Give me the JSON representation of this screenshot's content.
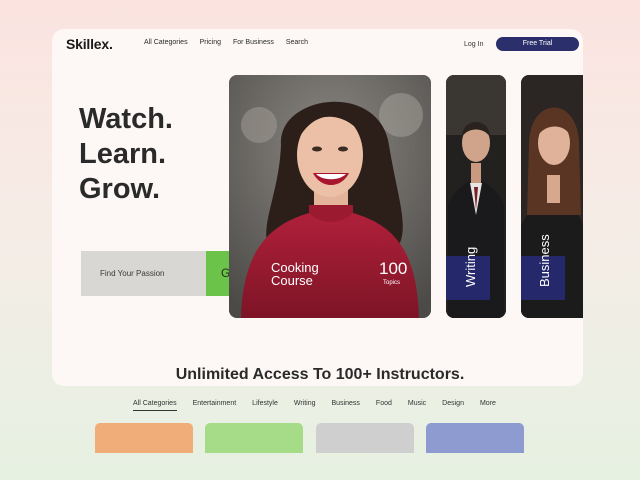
{
  "brand": {
    "name": "Skillex",
    "dot": "."
  },
  "nav": {
    "items": [
      "All Categories",
      "Pricing",
      "For Business",
      "Search"
    ],
    "login": "Log In",
    "trial": "Free Trial"
  },
  "hero": {
    "lines": [
      "Watch.",
      "Learn.",
      "Grow."
    ],
    "search_placeholder": "Find Your Passion",
    "go": "Go",
    "course_line1": "Cooking",
    "course_line2": "Course",
    "topics_count": "100",
    "topics_label": "Topics",
    "side_cards": [
      "Writing",
      "Business"
    ]
  },
  "section": {
    "title": "Unlimited Access To 100+ Instructors.",
    "tabs": [
      "All Categories",
      "Entertainment",
      "Lifestyle",
      "Writing",
      "Business",
      "Food",
      "Music",
      "Design",
      "More"
    ],
    "active_tab": "All Categories"
  },
  "colors": {
    "accent_navy": "#2b2f6b",
    "go_green": "#6cc349",
    "swatches": [
      "#f0ad7a",
      "#a6dc87",
      "#cfcfcf",
      "#8d9bd0"
    ]
  }
}
